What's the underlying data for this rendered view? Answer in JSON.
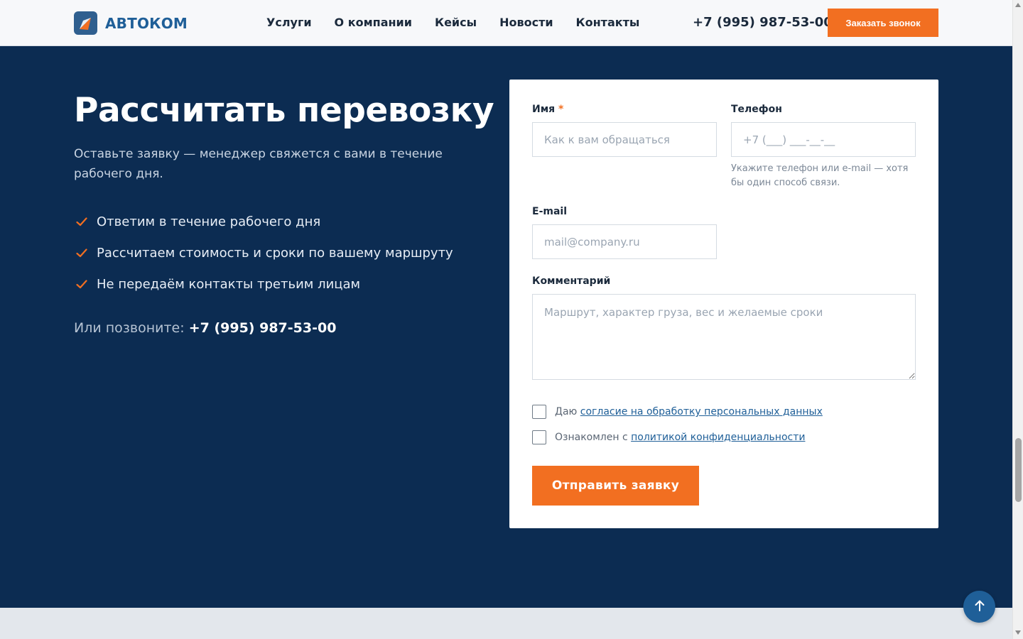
{
  "header": {
    "logo_text": "АВТОКОМ",
    "nav": [
      "Услуги",
      "О компании",
      "Кейсы",
      "Новости",
      "Контакты"
    ],
    "phone": "+7 (995) 987-53-00",
    "cta_label": "Заказать звонок"
  },
  "hero": {
    "title": "Рассчитать перевозку",
    "subtitle": "Оставьте заявку — менеджер свяжется с вами в течение рабочего дня.",
    "benefits": [
      "Ответим в течение рабочего дня",
      "Рассчитаем стоимость и сроки по вашему маршруту",
      "Не передаём контакты третьим лицам"
    ],
    "call_prefix": "Или позвоните:",
    "call_phone": "+7 (995) 987-53-00"
  },
  "form": {
    "name_label": "Имя",
    "name_required_mark": "*",
    "name_placeholder": "Как к вам обращаться",
    "phone_label": "Телефон",
    "phone_placeholder": "+7 (___) ___-__-__",
    "phone_hint": "Укажите телефон или e-mail — хотя бы один способ связи.",
    "email_label": "E-mail",
    "email_placeholder": "mail@company.ru",
    "comment_label": "Комментарий",
    "comment_placeholder": "Маршрут, характер груза, вес и желаемые сроки",
    "consent1_prefix": "Даю",
    "consent1_link": "согласие на обработку персональных данных",
    "consent2_prefix": "Ознакомлен с",
    "consent2_link": "политикой конфиденциальности",
    "submit_label": "Отправить заявку"
  },
  "colors": {
    "accent": "#f26f21",
    "brand": "#1f5f98",
    "hero_bg": "#0c2c52"
  },
  "icons": {
    "logo": "logo-mark-icon",
    "check": "check-icon",
    "to_top": "arrow-up-icon"
  }
}
